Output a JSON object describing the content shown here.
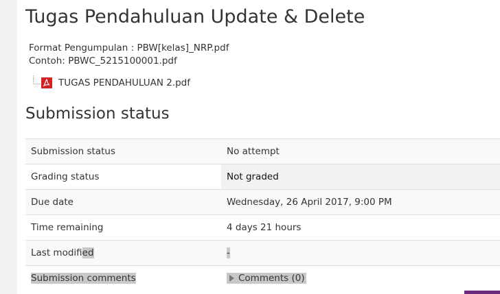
{
  "page": {
    "title": "Tugas Pendahuluan Update & Delete",
    "intro_lines": [
      "Format Pengumpulan : PBW[kelas]_NRP.pdf",
      "Contoh: PBWC_5215100001.pdf"
    ],
    "attachment": {
      "file_name": "TUGAS PENDAHULUAN 2.pdf",
      "icon": "pdf-file-icon"
    }
  },
  "submission": {
    "section_title": "Submission status",
    "rows": [
      {
        "label": "Submission status",
        "value": "No attempt"
      },
      {
        "label": "Grading status",
        "value": "Not graded"
      },
      {
        "label": "Due date",
        "value": "Wednesday, 26 April 2017, 9:00 PM"
      },
      {
        "label": "Time remaining",
        "value": "4 days 21 hours"
      },
      {
        "label": "Last modified",
        "value": "-"
      },
      {
        "label": "Submission comments",
        "value": "Comments (0)"
      }
    ],
    "last_modified_label_part1": "Last modifi",
    "last_modified_label_part2": "ed",
    "comments_icon": "chevron-right-icon"
  },
  "colors": {
    "text": "#333333",
    "selection": "#c8c8c8",
    "pdf_red": "#d42121",
    "accent_purple": "#6b2a7d"
  }
}
